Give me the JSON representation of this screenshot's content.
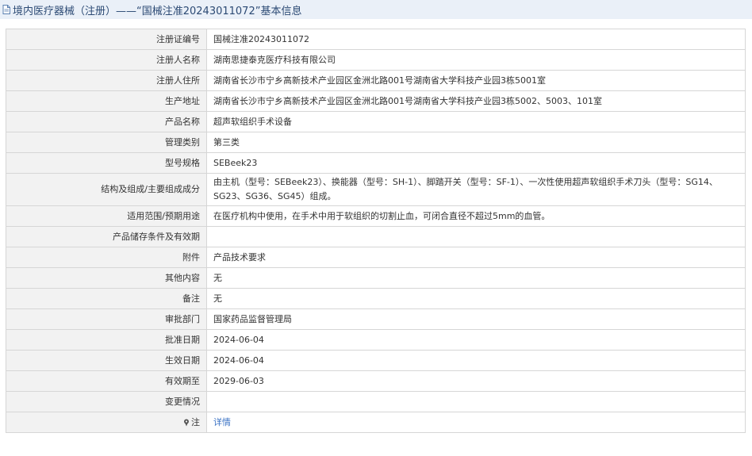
{
  "header": {
    "title": "境内医疗器械（注册）——“国械注准20243011072”基本信息",
    "icon": "document-icon"
  },
  "table": {
    "rows": [
      {
        "label": "注册证编号",
        "value": "国械注准20243011072"
      },
      {
        "label": "注册人名称",
        "value": "湖南思捷泰克医疗科技有限公司"
      },
      {
        "label": "注册人住所",
        "value": "湖南省长沙市宁乡高新技术产业园区金洲北路001号湖南省大学科技产业园3栋5001室"
      },
      {
        "label": "生产地址",
        "value": "湖南省长沙市宁乡高新技术产业园区金洲北路001号湖南省大学科技产业园3栋5002、5003、101室"
      },
      {
        "label": "产品名称",
        "value": "超声软组织手术设备"
      },
      {
        "label": "管理类别",
        "value": "第三类"
      },
      {
        "label": "型号规格",
        "value": "SEBeek23"
      },
      {
        "label": "结构及组成/主要组成成分",
        "value": "由主机（型号：SEBeek23）、换能器（型号：SH-1）、脚踏开关（型号：SF-1）、一次性使用超声软组织手术刀头（型号：SG14、SG23、SG36、SG45）组成。"
      },
      {
        "label": "适用范围/预期用途",
        "value": "在医疗机构中使用，在手术中用于软组织的切割止血，可闭合直径不超过5mm的血管。"
      },
      {
        "label": "产品储存条件及有效期",
        "value": ""
      },
      {
        "label": "附件",
        "value": "产品技术要求"
      },
      {
        "label": "其他内容",
        "value": "无"
      },
      {
        "label": "备注",
        "value": "无"
      },
      {
        "label": "审批部门",
        "value": "国家药品监督管理局"
      },
      {
        "label": "批准日期",
        "value": "2024-06-04"
      },
      {
        "label": "生效日期",
        "value": "2024-06-04"
      },
      {
        "label": "有效期至",
        "value": "2029-06-03"
      },
      {
        "label": "变更情况",
        "value": ""
      }
    ],
    "note_row": {
      "label": "注",
      "icon": "pin-icon",
      "link_text": "详情"
    }
  },
  "colors": {
    "header_bg": "#eaf0f8",
    "header_text": "#2c4a74",
    "label_bg": "#f2f2f2",
    "border": "#d6d6d6",
    "link": "#3a72c4"
  }
}
